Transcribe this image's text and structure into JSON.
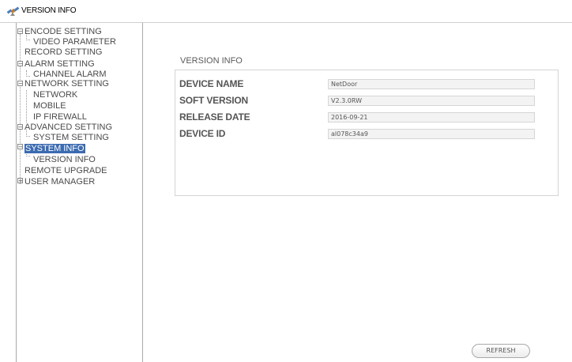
{
  "window": {
    "title": "VERSION INFO",
    "icon": "satellite-icon"
  },
  "sidebar": {
    "items": [
      {
        "label": "ENCODE SETTING",
        "level": 0,
        "toggle": "-"
      },
      {
        "label": "VIDEO PARAMETER",
        "level": 1
      },
      {
        "label": "RECORD SETTING",
        "level": 0
      },
      {
        "label": "ALARM SETTING",
        "level": 0,
        "toggle": "-"
      },
      {
        "label": "CHANNEL ALARM",
        "level": 1
      },
      {
        "label": "NETWORK SETTING",
        "level": 0,
        "toggle": "-"
      },
      {
        "label": "NETWORK",
        "level": 1
      },
      {
        "label": "MOBILE",
        "level": 1
      },
      {
        "label": "IP FIREWALL",
        "level": 1
      },
      {
        "label": "ADVANCED SETTING",
        "level": 0,
        "toggle": "-"
      },
      {
        "label": "SYSTEM SETTING",
        "level": 1
      },
      {
        "label": "SYSTEM INFO",
        "level": 0,
        "toggle": "-",
        "selected": true
      },
      {
        "label": "VERSION INFO",
        "level": 1
      },
      {
        "label": "REMOTE UPGRADE",
        "level": 0
      },
      {
        "label": "USER MANAGER",
        "level": 0,
        "toggle": "+"
      }
    ]
  },
  "main": {
    "section_title": "VERSION INFO",
    "rows": [
      {
        "label": "DEVICE NAME",
        "value": "NetDoor"
      },
      {
        "label": "SOFT VERSION",
        "value": "V2.3.0RW"
      },
      {
        "label": "RELEASE DATE",
        "value": "2016-09-21"
      },
      {
        "label": "DEVICE ID",
        "value": "al078c34a9"
      }
    ],
    "refresh_label": "REFRESH"
  },
  "colors": {
    "selection": "#3c6bb0",
    "border": "#a9a9a9"
  }
}
